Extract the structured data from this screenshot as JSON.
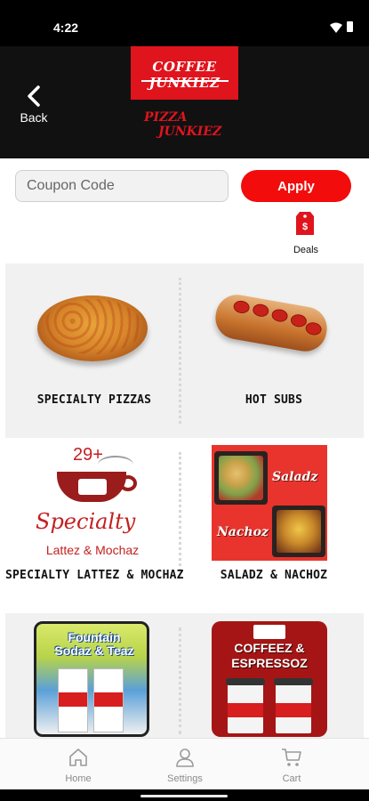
{
  "status_bar": {
    "time": "4:22"
  },
  "header": {
    "back_label": "Back",
    "logo_top": "COFFEE JUNKIEZ",
    "logo_bottom_line1": "PIZZA",
    "logo_bottom_line2": "JUNKIEZ"
  },
  "coupon": {
    "placeholder": "Coupon Code",
    "apply_label": "Apply"
  },
  "deals": {
    "label": "Deals",
    "icon": "price-tag-dollar-icon"
  },
  "categories": [
    {
      "label": "SPECIALTY PIZZAS"
    },
    {
      "label": "HOT SUBS"
    },
    {
      "label": "SPECIALTY LATTEZ & MOCHAZ",
      "image_text": {
        "count": "29+",
        "title": "Specialty",
        "subtitle": "Lattez & Mochaz"
      }
    },
    {
      "label": "SALADZ & NACHOZ",
      "image_text": {
        "top": "Saladz",
        "bottom": "Nachoz"
      }
    },
    {
      "label": "",
      "image_text": {
        "title": "Fountain Sodaz & Teaz"
      }
    },
    {
      "label": "",
      "image_text": {
        "title": "COFFEEZ & ESPRESSOZ"
      }
    }
  ],
  "bottom_nav": [
    {
      "label": "Home",
      "icon": "home-icon"
    },
    {
      "label": "Settings",
      "icon": "user-icon"
    },
    {
      "label": "Cart",
      "icon": "cart-icon"
    }
  ],
  "colors": {
    "brand_red": "#e0141d",
    "apply_red": "#f20c0c",
    "header_bg": "#111111"
  }
}
